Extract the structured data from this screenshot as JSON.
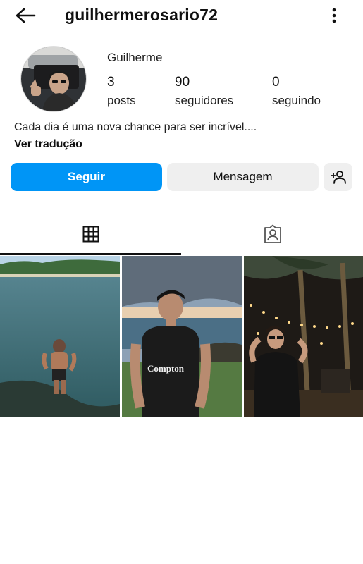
{
  "header": {
    "back_icon": "arrow-left-icon",
    "username": "guilhermerosario72",
    "more_icon": "more-vertical-icon"
  },
  "profile": {
    "display_name": "Guilherme",
    "stats": {
      "posts": {
        "value": "3",
        "label": "posts"
      },
      "followers": {
        "value": "90",
        "label": "seguidores"
      },
      "following": {
        "value": "0",
        "label": "seguindo"
      }
    },
    "bio": "Cada dia é uma nova chance para ser incrível....",
    "translate_label": "Ver tradução"
  },
  "actions": {
    "follow_label": "Seguir",
    "message_label": "Mensagem",
    "suggest_icon": "add-person-icon"
  },
  "tabs": [
    {
      "name": "grid",
      "icon": "grid-icon",
      "active": true
    },
    {
      "name": "tagged",
      "icon": "tagged-person-icon",
      "active": false
    }
  ],
  "posts_grid": [
    {
      "scene": "lake-shore"
    },
    {
      "scene": "beach-compton-shirt"
    },
    {
      "scene": "palm-trees-night-lights"
    }
  ],
  "colors": {
    "accent": "#0095f6",
    "secondary_button": "#efefef",
    "text": "#111111"
  }
}
